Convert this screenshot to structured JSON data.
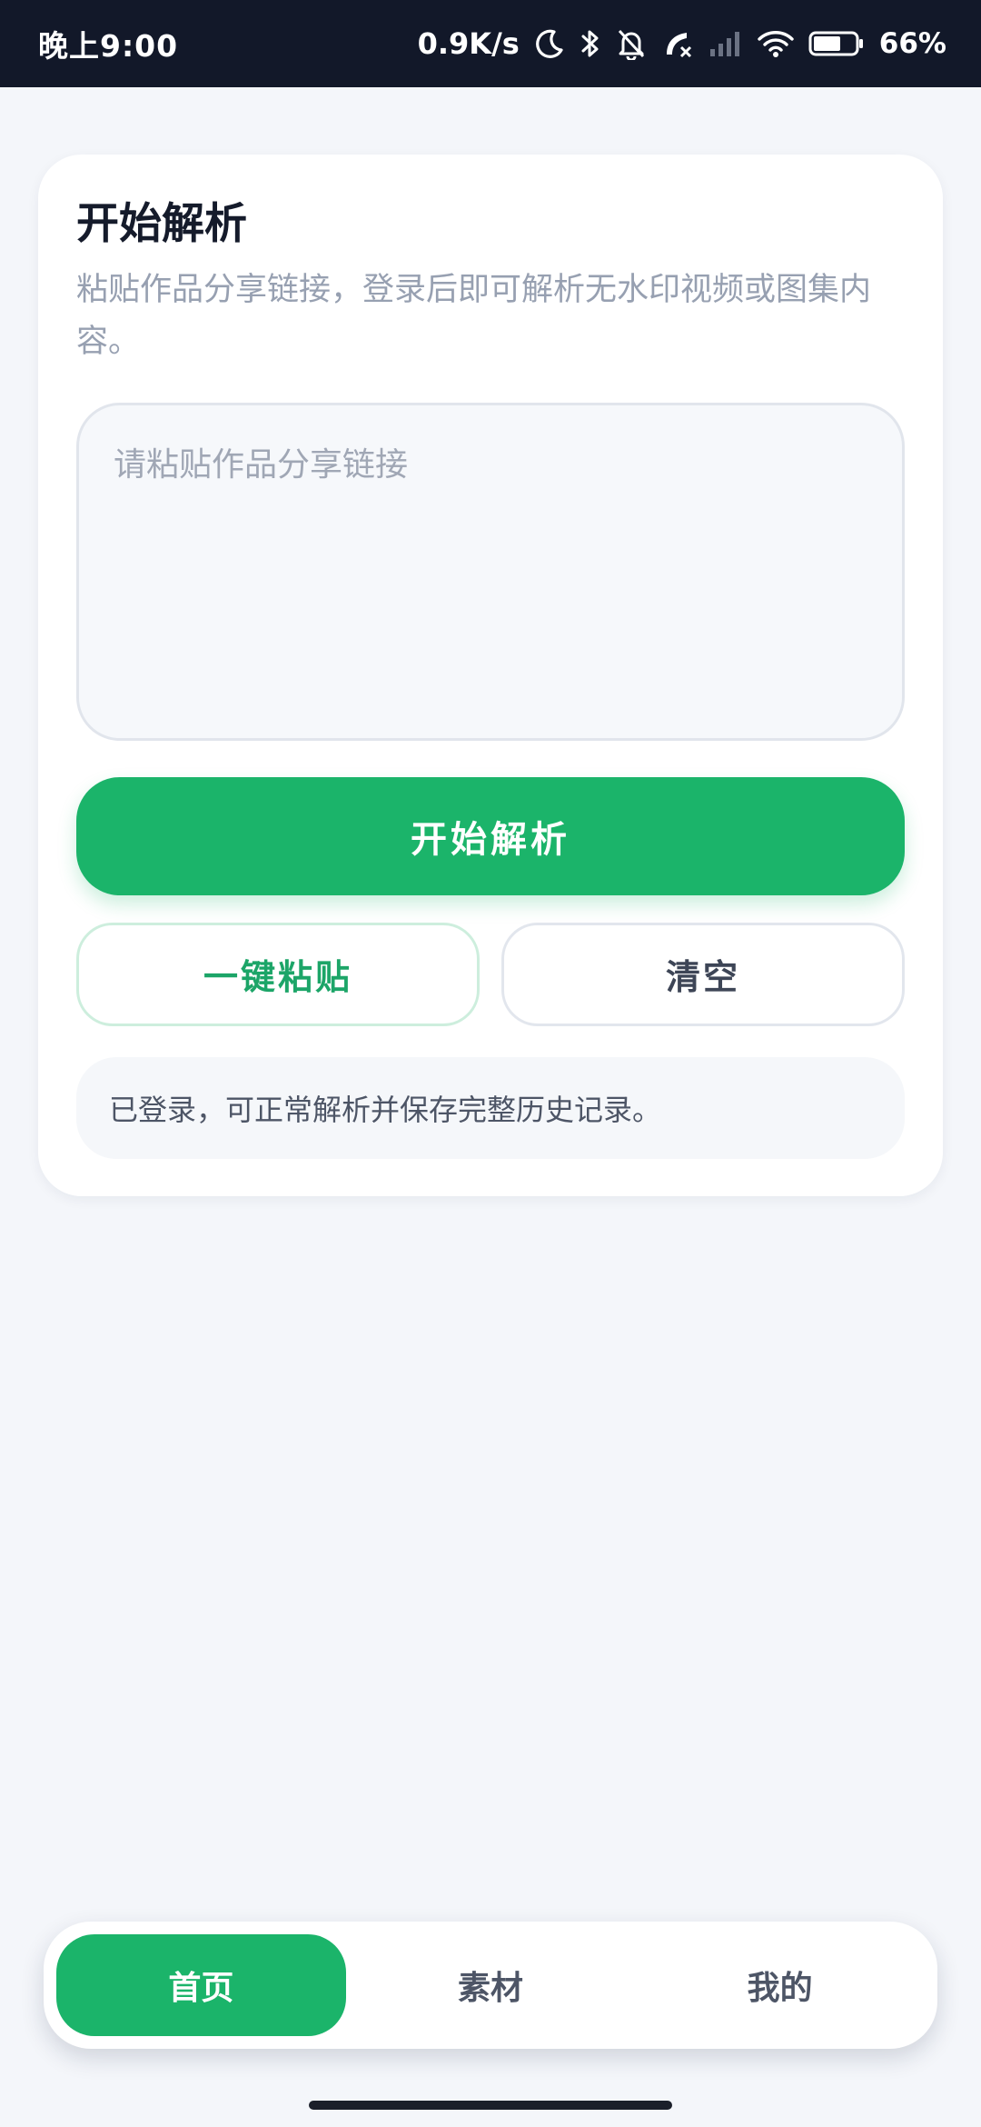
{
  "status_bar": {
    "time": "晚上9:00",
    "net_speed": "0.9K/s",
    "battery": "66%",
    "icons": [
      "moon-icon",
      "bluetooth-icon",
      "bell-muted-icon",
      "call-missed-icon",
      "signal-icon",
      "wifi-icon",
      "battery-icon"
    ],
    "battery_level": 0.66
  },
  "card": {
    "title": "开始解析",
    "description": "粘贴作品分享链接，登录后即可解析无水印视频或图集内容。",
    "input": {
      "placeholder": "请粘贴作品分享链接",
      "value": ""
    },
    "start_button": "开始解析",
    "paste_button": "一键粘贴",
    "clear_button": "清空",
    "login_status": "已登录，可正常解析并保存完整历史记录。"
  },
  "tabs": [
    {
      "label": "首页",
      "active": true
    },
    {
      "label": "素材",
      "active": false
    },
    {
      "label": "我的",
      "active": false
    }
  ],
  "colors": {
    "accent": "#1bb46a",
    "status_bar_bg": "#121829",
    "page_bg": "#f4f6fa"
  }
}
